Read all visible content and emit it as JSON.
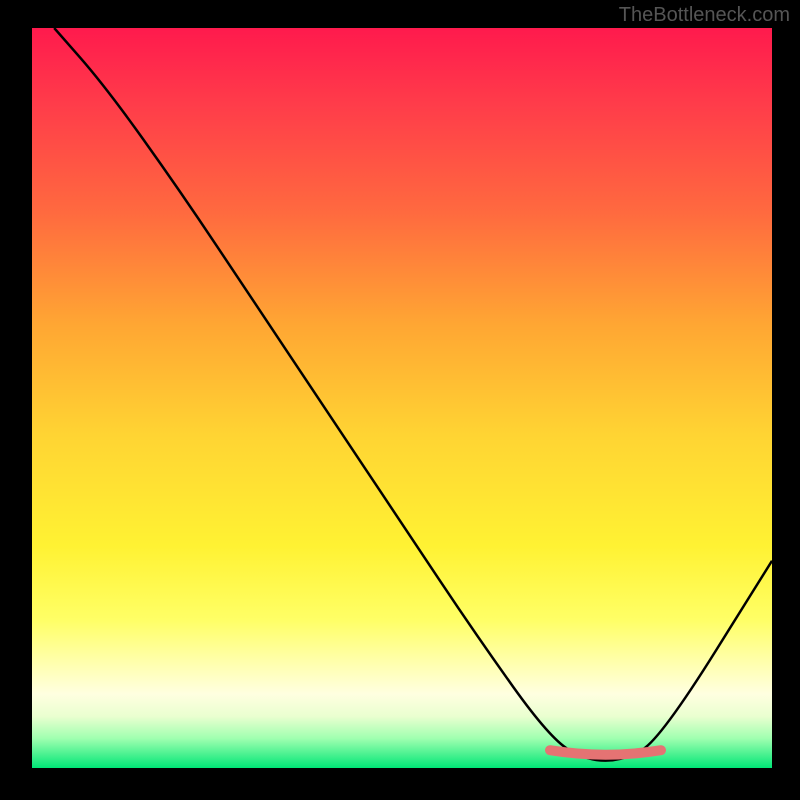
{
  "watermark": "TheBottleneck.com",
  "chart_data": {
    "type": "line",
    "title": "",
    "xlabel": "",
    "ylabel": "",
    "xlim": [
      0,
      100
    ],
    "ylim": [
      0,
      100
    ],
    "series": [
      {
        "name": "curve",
        "x": [
          3,
          10,
          20,
          30,
          40,
          50,
          60,
          70,
          75,
          80,
          85,
          100
        ],
        "y": [
          100,
          92,
          78,
          63,
          48,
          33,
          18,
          4,
          1,
          1,
          4,
          28
        ]
      }
    ],
    "flat_region": {
      "x_start": 70,
      "x_end": 85,
      "y": 2
    },
    "colors": {
      "curve": "#000000",
      "flat_marker": "#e57373",
      "gradient_top": "#ff1744",
      "gradient_mid": "#ffeb3b",
      "gradient_bottom": "#00e676"
    }
  }
}
